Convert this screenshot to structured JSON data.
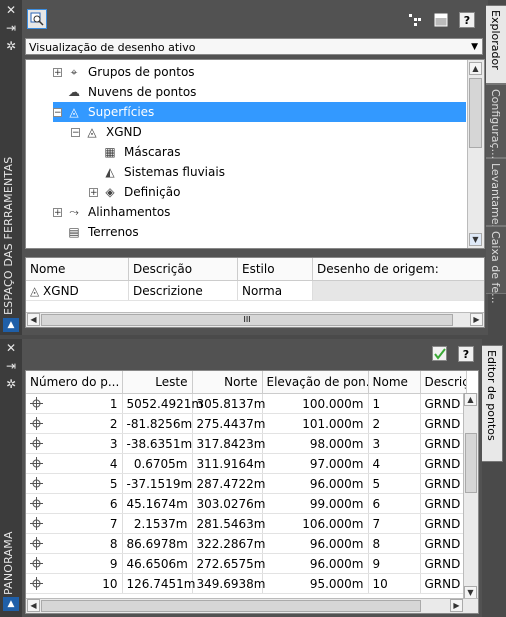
{
  "palette_top": {
    "side_title": "ESPAÇO DAS FERRAMENTAS",
    "tabs": [
      "Explorador",
      "Configuraç...",
      "Levantame...",
      "Caixa de fe..."
    ],
    "view_dropdown": "Visualização de desenho ativo",
    "tree": [
      {
        "label": "Grupos de pontos",
        "icon": "point-groups-icon",
        "expander": "+",
        "level": 0
      },
      {
        "label": "Nuvens de pontos",
        "icon": "point-cloud-icon",
        "expander": "",
        "level": 0
      },
      {
        "label": "Superfícies",
        "icon": "surfaces-icon",
        "expander": "-",
        "level": 0,
        "selected": true
      },
      {
        "label": "XGND",
        "icon": "surface-icon",
        "expander": "-",
        "level": 1
      },
      {
        "label": "Máscaras",
        "icon": "masks-icon",
        "expander": "",
        "level": 2
      },
      {
        "label": "Sistemas fluviais",
        "icon": "watershed-icon",
        "expander": "",
        "level": 2
      },
      {
        "label": "Definição",
        "icon": "definition-icon",
        "expander": "+",
        "level": 2
      },
      {
        "label": "Alinhamentos",
        "icon": "alignments-icon",
        "expander": "+",
        "level": 0
      },
      {
        "label": "Terrenos",
        "icon": "parcels-icon",
        "expander": "",
        "level": 0
      }
    ],
    "list": {
      "headers": [
        "Nome",
        "Descrição",
        "Estilo",
        "Desenho de origem:"
      ],
      "rows": [
        {
          "nome": "XGND",
          "descricao": "Descrizione",
          "estilo": "Norma",
          "origem": ""
        }
      ]
    }
  },
  "palette_bottom": {
    "side_title": "PANORAMA",
    "tab": "Editor de pontos",
    "headers": [
      "Número do p...",
      "Leste",
      "Norte",
      "Elevação de pon...",
      "Nome",
      "Descriç"
    ],
    "rows": [
      {
        "n": "1",
        "leste": "5052.4921m",
        "norte": "305.8137m",
        "elev": "100.000m",
        "nome": "1",
        "desc": "GRND"
      },
      {
        "n": "2",
        "leste": "-81.8256m",
        "norte": "275.4437m",
        "elev": "101.000m",
        "nome": "2",
        "desc": "GRND"
      },
      {
        "n": "3",
        "leste": "-38.6351m",
        "norte": "317.8423m",
        "elev": "98.000m",
        "nome": "3",
        "desc": "GRND"
      },
      {
        "n": "4",
        "leste": "0.6705m",
        "norte": "311.9164m",
        "elev": "97.000m",
        "nome": "4",
        "desc": "GRND"
      },
      {
        "n": "5",
        "leste": "-37.1519m",
        "norte": "287.4722m",
        "elev": "96.000m",
        "nome": "5",
        "desc": "GRND"
      },
      {
        "n": "6",
        "leste": "45.1674m",
        "norte": "303.0276m",
        "elev": "99.000m",
        "nome": "6",
        "desc": "GRND"
      },
      {
        "n": "7",
        "leste": "2.1537m",
        "norte": "281.5463m",
        "elev": "106.000m",
        "nome": "7",
        "desc": "GRND"
      },
      {
        "n": "8",
        "leste": "86.6978m",
        "norte": "322.2867m",
        "elev": "96.000m",
        "nome": "8",
        "desc": "GRND"
      },
      {
        "n": "9",
        "leste": "46.6506m",
        "norte": "272.6575m",
        "elev": "96.000m",
        "nome": "9",
        "desc": "GRND"
      },
      {
        "n": "10",
        "leste": "126.7451m",
        "norte": "349.6938m",
        "elev": "95.000m",
        "nome": "10",
        "desc": "GRND"
      }
    ]
  },
  "colors": {
    "selection": "#3399ff",
    "panel_bg": "#525252",
    "accept_green": "#3aa935"
  },
  "scrollbar_thumb_label": "III"
}
